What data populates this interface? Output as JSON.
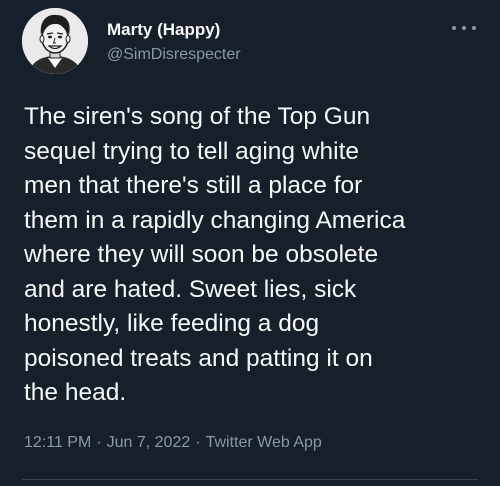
{
  "author": {
    "display_name": "Marty (Happy)",
    "handle": "@SimDisrespecter",
    "avatar_icon": "cartoon-portrait-avatar"
  },
  "tweet": {
    "text": "The siren's song of the Top Gun\nsequel trying to tell aging white\nmen that there's still a place for\nthem in a rapidly changing America\nwhere they will soon be obsolete\nand are hated. Sweet lies, sick\nhonestly, like feeding a dog\npoisoned treats and patting it on\nthe head.",
    "time": "12:11 PM",
    "date": "Jun 7, 2022",
    "source": "Twitter Web App",
    "separator": "·"
  },
  "colors": {
    "background": "#15202b",
    "primary_text": "#f7f9f9",
    "secondary_text": "#8b98a5",
    "divider": "#38444d"
  }
}
